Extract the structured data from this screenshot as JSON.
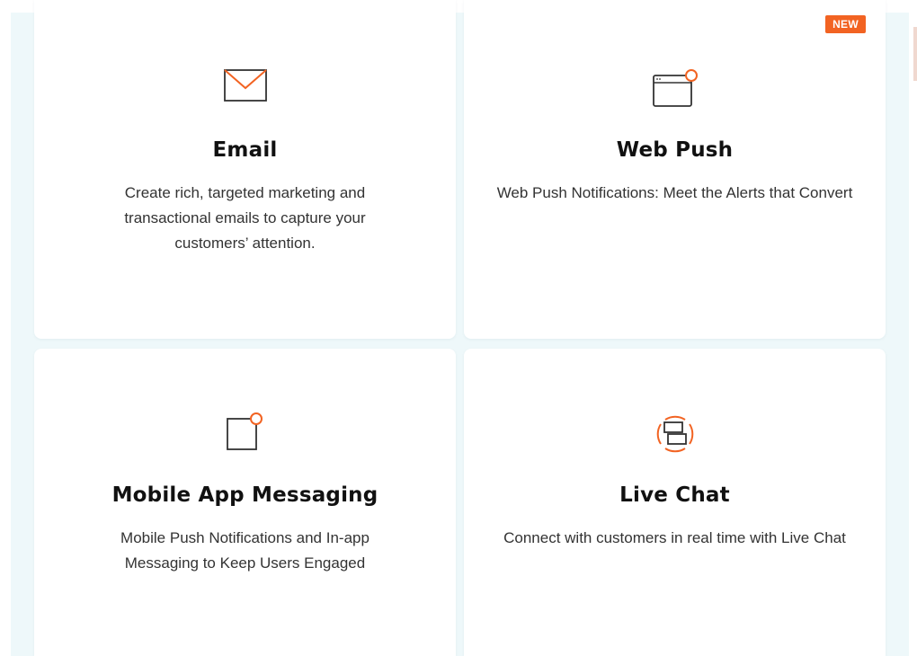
{
  "cards": [
    {
      "icon": "envelope-icon",
      "title": "Email",
      "description": "Create rich, targeted marketing and transactional emails to capture your customers’ attention."
    },
    {
      "icon": "browser-notification-icon",
      "title": "Web Push",
      "description": "Web Push Notifications: Meet the Alerts that Convert",
      "badge": "NEW"
    },
    {
      "icon": "app-notification-icon",
      "title": "Mobile App Messaging",
      "description": "Mobile Push Notifications and In-app Messaging to Keep Users Engaged"
    },
    {
      "icon": "chat-bubbles-icon",
      "title": "Live Chat",
      "description": "Connect with customers in real time with Live Chat"
    }
  ],
  "colors": {
    "accent": "#f26322",
    "background": "#eef8fa",
    "card": "#ffffff",
    "text": "#111111"
  }
}
